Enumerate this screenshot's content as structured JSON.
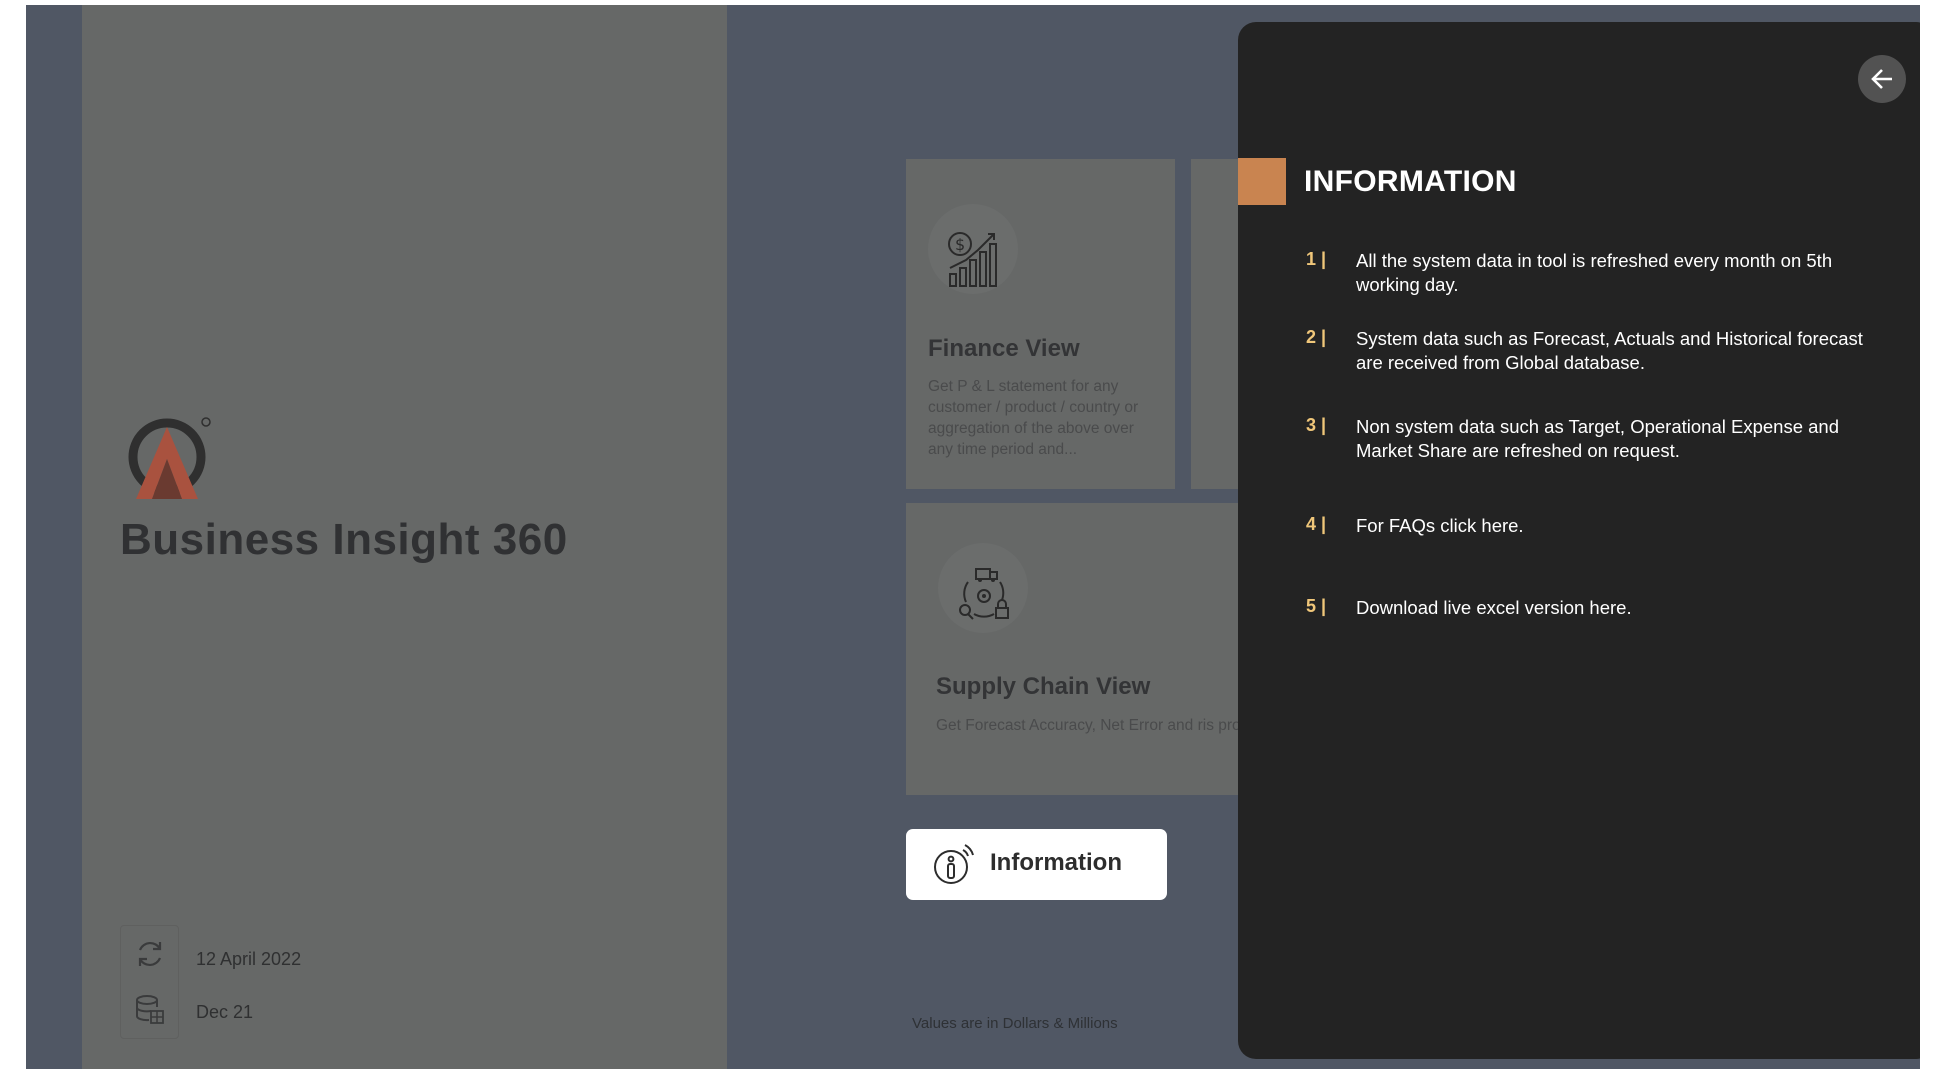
{
  "app": {
    "title": "Business Insight 360",
    "refresh_date": "12 April 2022",
    "data_period": "Dec 21"
  },
  "cards": [
    {
      "title": "Finance View",
      "description": "Get P & L statement for any customer / product / country or aggregation of the above over any time period and...",
      "icon": "finance-chart-icon"
    },
    {
      "title": "Supply Chain View",
      "description": "Get Forecast Accuracy, Net Error and ris product, segment, category, customer e",
      "icon": "supply-chain-icon"
    }
  ],
  "information_button": {
    "label": "Information",
    "icon": "info-icon"
  },
  "footer_note": "Values are in Dollars & Millions",
  "info_panel": {
    "title": "INFORMATION",
    "items": [
      {
        "num": "1 |",
        "text": "All the system data in tool is refreshed every month on 5th working day."
      },
      {
        "num": "2 |",
        "text": "System data such as Forecast, Actuals and Historical forecast are received from Global database."
      },
      {
        "num": "3 |",
        "text": "Non system data such as Target, Operational Expense and Market Share are refreshed on request."
      },
      {
        "num": "4 |",
        "text": "For FAQs click here."
      },
      {
        "num": "5 |",
        "text": "Download live excel version here."
      }
    ]
  },
  "colors": {
    "accent": "#c98450",
    "number_color": "#f0c77a",
    "panel_bg": "#232323",
    "page_bg": "#505764",
    "left_panel_bg": "#666867"
  }
}
